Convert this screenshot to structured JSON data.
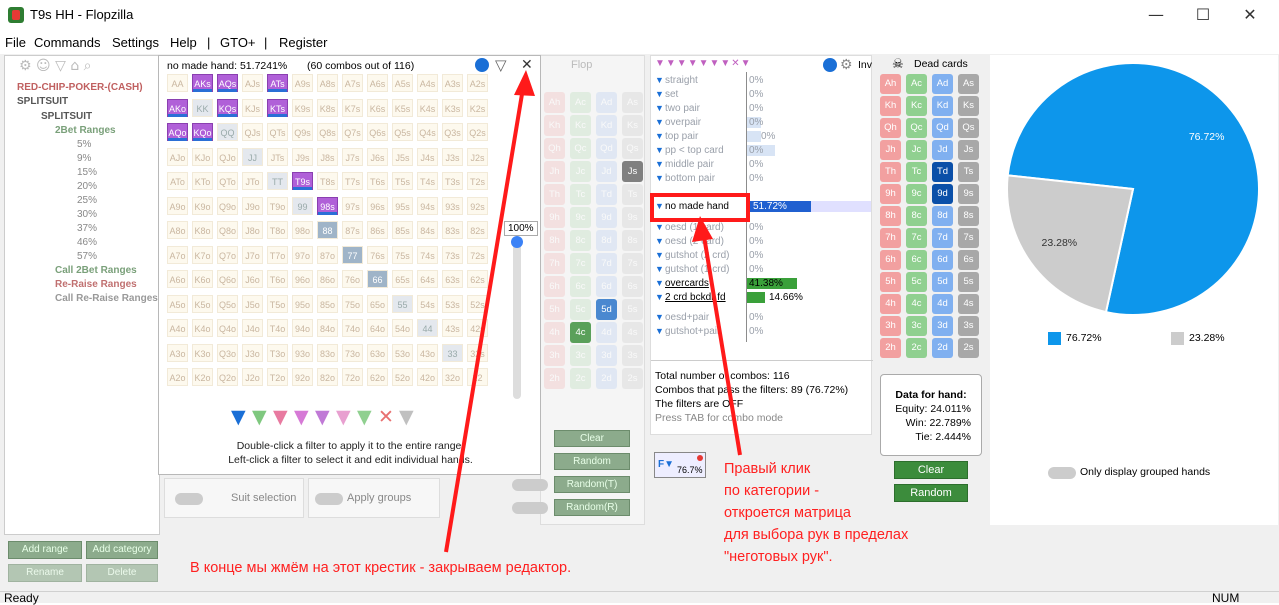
{
  "window": {
    "title": "T9s HH - Flopzilla",
    "minimize": "—",
    "maximize": "☐",
    "close": "✕"
  },
  "menu": [
    "File",
    "Commands",
    "Settings",
    "Help",
    "|",
    "GTO+",
    "|",
    "Register"
  ],
  "tree": {
    "items": [
      {
        "label": "RED-CHIP-POKER-(CASH)",
        "color": "#c06060",
        "bold": true
      },
      {
        "label": "SPLITSUIT",
        "color": "#555",
        "bold": true
      },
      {
        "label": "SPLITSUIT",
        "color": "#555",
        "bold": true
      },
      {
        "label": "2Bet Ranges",
        "color": "#7aa07a",
        "bold": true
      },
      {
        "label": "5%",
        "color": "#888"
      },
      {
        "label": "9%",
        "color": "#888"
      },
      {
        "label": "15%",
        "color": "#888"
      },
      {
        "label": "20%",
        "color": "#888"
      },
      {
        "label": "25%",
        "color": "#888"
      },
      {
        "label": "30%",
        "color": "#888"
      },
      {
        "label": "37%",
        "color": "#888"
      },
      {
        "label": "46%",
        "color": "#888"
      },
      {
        "label": "57%",
        "color": "#888"
      },
      {
        "label": "Call 2Bet Ranges",
        "color": "#7aa07a",
        "bold": true
      },
      {
        "label": "Re-Raise Ranges",
        "color": "#c07070",
        "bold": true
      },
      {
        "label": "Call Re-Raise Ranges",
        "color": "#999",
        "bold": true
      }
    ],
    "add_range": "Add range",
    "add_category": "Add category",
    "rename": "Rename",
    "delete": "Delete"
  },
  "editor": {
    "header": "no made hand: 51.7241%",
    "combos": "(60 combos out of 116)",
    "slider": "100%",
    "hint1": "Double-click a filter to apply it to the entire range.",
    "hint2": "Left-click a filter to select it and edit individual hands.",
    "highlighted": [
      "AKs",
      "AQs",
      "ATs",
      "AKo",
      "KQs",
      "KTs",
      "AQo",
      "KQo",
      "T9s",
      "98s"
    ],
    "grey": [
      "KK",
      "QQ",
      "JJ",
      "99",
      "88",
      "77",
      "66",
      "55",
      "44",
      "33",
      "TT"
    ],
    "suit_selection": "Suit selection",
    "apply_groups": "Apply groups"
  },
  "flop": {
    "label": "Flop",
    "clear": "Clear",
    "random": "Random",
    "random_t": "Random(T)",
    "random_r": "Random(R)",
    "visible_cards": [
      "4c",
      "5d",
      "Js"
    ]
  },
  "filters": {
    "categories": [
      {
        "name": "straight",
        "pct": "0%"
      },
      {
        "name": "set",
        "pct": "0%"
      },
      {
        "name": "two pair",
        "pct": "0%"
      },
      {
        "name": "overpair",
        "pct": "0%"
      },
      {
        "name": "top pair",
        "pct": "0%"
      },
      {
        "name": "pp < top card",
        "pct": "0%"
      },
      {
        "name": "middle pair",
        "pct": "0%"
      },
      {
        "name": "bottom pair",
        "pct": "0%"
      },
      {
        "name": "no made hand",
        "pct": "51.72%"
      },
      {
        "name": "oesd (1 card)",
        "pct": "0%"
      },
      {
        "name": "oesd (2 card)",
        "pct": "0%"
      },
      {
        "name": "gutshot (2 crd)",
        "pct": "0%"
      },
      {
        "name": "gutshot (1 crd)",
        "pct": "0%"
      },
      {
        "name": "overcards",
        "pct": "41.38%"
      },
      {
        "name": "2 crd bckdr fd",
        "pct": "14.66%"
      },
      {
        "name": "oesd+pair",
        "pct": "0%"
      },
      {
        "name": "gutshot+pair",
        "pct": "0%"
      }
    ],
    "inv": "Inv",
    "total": "Total number of combos: 116",
    "pass": "Combos that pass the filters: 89 (76.72%)",
    "filters_are": "The filters are OFF",
    "press_tab": "Press TAB for combo mode",
    "badge": "76.7%"
  },
  "dead_cards": {
    "title": "Dead cards",
    "ranks": [
      "A",
      "K",
      "Q",
      "J",
      "T",
      "9",
      "8",
      "7",
      "6",
      "5",
      "4",
      "3",
      "2"
    ],
    "suits": [
      "h",
      "c",
      "d",
      "s"
    ],
    "selected": [
      "Td",
      "9d"
    ],
    "clear": "Clear",
    "random": "Random",
    "data_title": "Data for hand:",
    "equity": "Equity: 24.011%",
    "win": "Win: 22.789%",
    "tie": "Tie: 2.444%"
  },
  "pie": {
    "chart_data": {
      "type": "pie",
      "slices": [
        {
          "label": "76.72%",
          "value": 76.72,
          "color": "#0d96eb"
        },
        {
          "label": "23.28%",
          "value": 23.28,
          "color": "#cccccc"
        }
      ]
    },
    "legend": [
      "76.72%",
      "23.28%"
    ],
    "only_grouped": "Only display grouped hands"
  },
  "annotations": {
    "bottom": "В конце мы жмём на этот крестик - закрываем редактор.",
    "right": [
      "Правый клик",
      "по категории -",
      "откроется матрица",
      "для выбора рук в пределах",
      "\"неготовых рук\"."
    ]
  },
  "status": {
    "left": "Ready",
    "right": "NUM"
  }
}
